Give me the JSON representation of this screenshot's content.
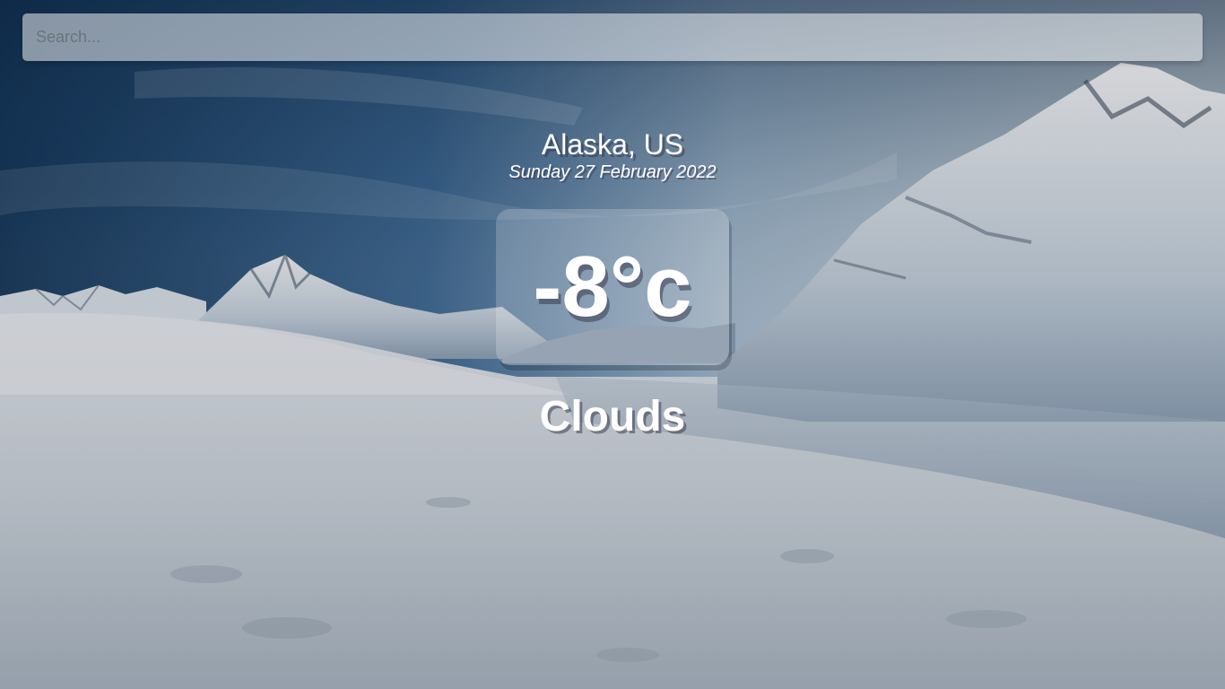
{
  "search": {
    "placeholder": "Search...",
    "value": ""
  },
  "location": {
    "name": "Alaska, US",
    "date": "Sunday 27 February 2022"
  },
  "weather": {
    "temperature": "-8°c",
    "condition": "Clouds"
  },
  "background": {
    "icon": "snowy-mountain-landscape"
  }
}
